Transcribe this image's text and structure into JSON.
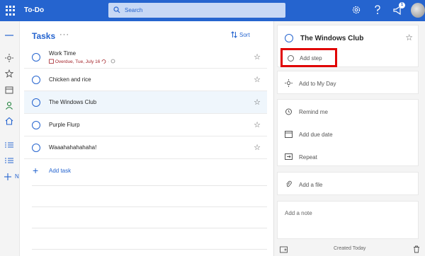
{
  "app": {
    "title": "To-Do"
  },
  "search": {
    "placeholder": "Search"
  },
  "header": {
    "badge_count": "1",
    "icons": [
      "settings-icon",
      "megaphone-icon",
      "avatar"
    ]
  },
  "rail": {
    "icons": [
      "menu-icon",
      "sun-icon",
      "star-icon",
      "calendar-icon",
      "person-icon",
      "home-icon",
      "list-icon",
      "list-icon",
      "plus-icon"
    ],
    "new_list_letter": "N"
  },
  "tasks": {
    "title": "Tasks",
    "more": "···",
    "sort_label": "Sort",
    "items": [
      {
        "title": "Work Time",
        "meta": "Overdue, Tue, July 16",
        "starred": false
      },
      {
        "title": "Chicken and rice",
        "starred": false
      },
      {
        "title": "The Windows Club",
        "starred": false,
        "selected": true
      },
      {
        "title": "Purple Flurp",
        "starred": false
      },
      {
        "title": "Waaahahahahaha!",
        "starred": false
      }
    ],
    "add_task_label": "Add task"
  },
  "detail": {
    "task_title": "The Windows Club",
    "add_step_label": "Add step",
    "add_to_my_day_label": "Add to My Day",
    "remind_me_label": "Remind me",
    "add_due_date_label": "Add due date",
    "repeat_label": "Repeat",
    "add_file_label": "Add a file",
    "note_placeholder": "Add a note",
    "created_label": "Created Today"
  },
  "colors": {
    "accent": "#2564cf",
    "overdue": "#a4262c",
    "highlight_box": "#e00000"
  }
}
